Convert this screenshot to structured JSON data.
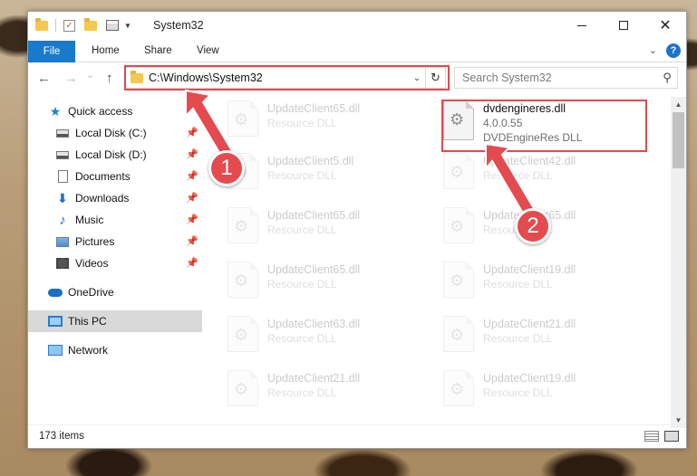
{
  "window": {
    "title": "System32",
    "controls": {
      "minimize": "",
      "maximize": "",
      "close": "✕"
    }
  },
  "ribbon": {
    "file": "File",
    "tabs": [
      "Home",
      "Share",
      "View"
    ],
    "help": "?"
  },
  "navigation": {
    "back": "←",
    "forward": "→",
    "recent": "⌄",
    "up": "↑",
    "address": "C:\\Windows\\System32",
    "refresh": "↻",
    "search_placeholder": "Search System32"
  },
  "sidebar": {
    "items": [
      {
        "label": "Quick access",
        "icon": "star-icon",
        "pinned": false
      },
      {
        "label": "Local Disk (C:)",
        "icon": "drive-icon",
        "pinned": true
      },
      {
        "label": "Local Disk (D:)",
        "icon": "drive-icon",
        "pinned": true
      },
      {
        "label": "Documents",
        "icon": "document-icon",
        "pinned": true
      },
      {
        "label": "Downloads",
        "icon": "download-icon",
        "pinned": true
      },
      {
        "label": "Music",
        "icon": "music-icon",
        "pinned": true
      },
      {
        "label": "Pictures",
        "icon": "pictures-icon",
        "pinned": true
      },
      {
        "label": "Videos",
        "icon": "videos-icon",
        "pinned": true
      },
      {
        "label": "OneDrive",
        "icon": "onedrive-icon",
        "pinned": false
      },
      {
        "label": "This PC",
        "icon": "this-pc-icon",
        "pinned": false,
        "selected": true
      },
      {
        "label": "Network",
        "icon": "network-icon",
        "pinned": false
      }
    ]
  },
  "files": [
    {
      "name": "UpdateClient65.dll",
      "sub": "Resource DLL",
      "faded": true
    },
    {
      "name": "dvdengineres.dll",
      "version": "4.0.0.55",
      "sub": "DVDEngineRes DLL",
      "faded": false,
      "highlighted": true
    },
    {
      "name": "UpdateClient5.dll",
      "sub": "Resource DLL",
      "faded": true
    },
    {
      "name": "UpdateClient42.dll",
      "sub": "Resource DLL",
      "faded": true
    },
    {
      "name": "UpdateClient65.dll",
      "sub": "Resource DLL",
      "faded": true
    },
    {
      "name": "UpdateClient65.dll",
      "sub": "Resource DLL",
      "faded": true
    },
    {
      "name": "UpdateClient65.dll",
      "sub": "Resource DLL",
      "faded": true
    },
    {
      "name": "UpdateClient19.dll",
      "sub": "Resource DLL",
      "faded": true
    },
    {
      "name": "UpdateClient63.dll",
      "sub": "Resource DLL",
      "faded": true
    },
    {
      "name": "UpdateClient21.dll",
      "sub": "Resource DLL",
      "faded": true
    },
    {
      "name": "UpdateClient21.dll",
      "sub": "Resource DLL",
      "faded": true
    },
    {
      "name": "UpdateClient19.dll",
      "sub": "Resource DLL",
      "faded": true
    }
  ],
  "status": {
    "item_count": "173 items"
  },
  "annotations": {
    "step1": "1",
    "step2": "2",
    "color": "#e44b4f"
  }
}
